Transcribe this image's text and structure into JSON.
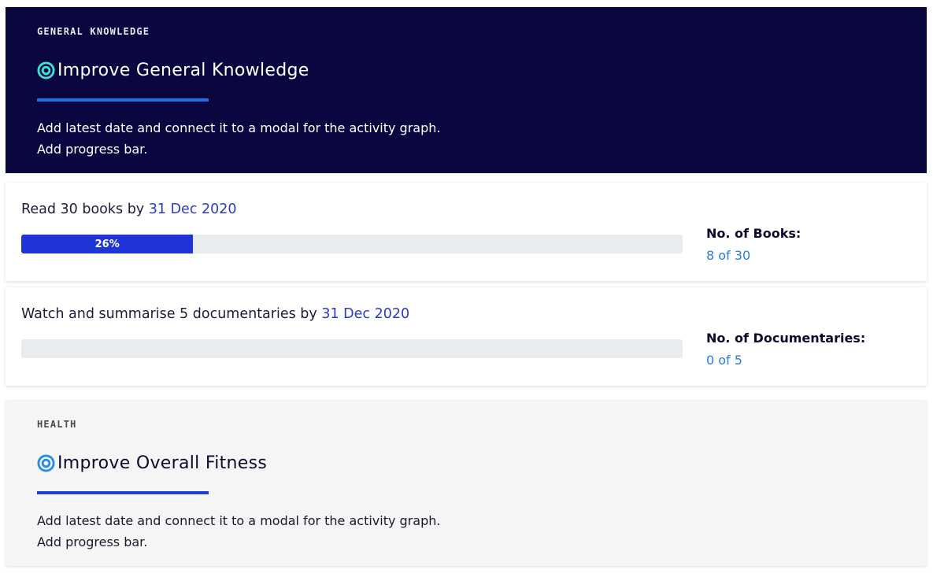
{
  "goals": [
    {
      "category": "GENERAL KNOWLEDGE",
      "icon": "target-icon",
      "title": "Improve General Knowledge",
      "description_lines": [
        "Add latest date and connect it to a modal for the activity graph.",
        "Add progress bar."
      ],
      "colors": {
        "background": "#0a0640",
        "icon": "#3ee0d0",
        "underline": "#1a73e8"
      }
    },
    {
      "category": "HEALTH",
      "icon": "target-icon",
      "title": "Improve Overall Fitness",
      "description_lines": [
        "Add latest date and connect it to a modal for the activity graph.",
        "Add progress bar."
      ],
      "colors": {
        "background": "#f5f5f5",
        "icon": "#2a8be8",
        "underline": "#1f3dd6"
      }
    }
  ],
  "tasks": [
    {
      "text": "Read 30 books by",
      "date": "31 Dec 2020",
      "progress_percent": 26,
      "progress_label": "26%",
      "count_label": "No. of Books:",
      "count_value": "8 of 30"
    },
    {
      "text": "Watch and summarise 5 documentaries by",
      "date": "31 Dec 2020",
      "progress_percent": 0,
      "progress_label": "",
      "count_label": "No. of Documentaries:",
      "count_value": "0 of 5"
    }
  ]
}
